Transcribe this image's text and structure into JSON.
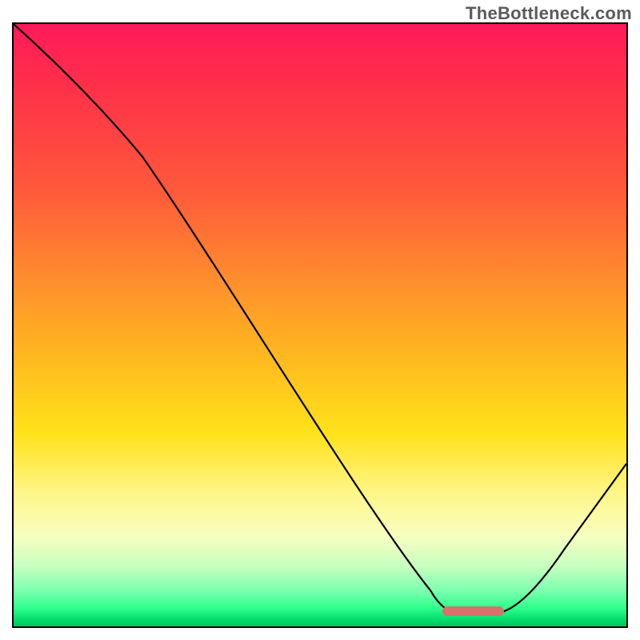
{
  "watermark": "TheBottleneck.com",
  "chart_data": {
    "type": "line",
    "title": "",
    "xlabel": "",
    "ylabel": "",
    "xlim": [
      0,
      100
    ],
    "ylim": [
      0,
      100
    ],
    "curve": {
      "x": [
        0,
        21,
        72,
        80,
        100
      ],
      "y": [
        100,
        78,
        2.5,
        2.5,
        27
      ]
    },
    "marker_segment": {
      "x0": 70,
      "x1": 80,
      "y": 2.5,
      "color": "#d9706b"
    },
    "gradient_stops": [
      {
        "pos": 0,
        "color": "#ff1a5a"
      },
      {
        "pos": 10,
        "color": "#ff2f4a"
      },
      {
        "pos": 28,
        "color": "#ff5a3a"
      },
      {
        "pos": 42,
        "color": "#ff8c2e"
      },
      {
        "pos": 55,
        "color": "#ffb81f"
      },
      {
        "pos": 68,
        "color": "#ffe21a"
      },
      {
        "pos": 78,
        "color": "#fff68a"
      },
      {
        "pos": 85,
        "color": "#f7ffc0"
      },
      {
        "pos": 90,
        "color": "#c8ffbf"
      },
      {
        "pos": 94,
        "color": "#7dffb0"
      },
      {
        "pos": 97,
        "color": "#2dff8a"
      },
      {
        "pos": 99,
        "color": "#00d96a"
      },
      {
        "pos": 100,
        "color": "#00c060"
      }
    ]
  }
}
